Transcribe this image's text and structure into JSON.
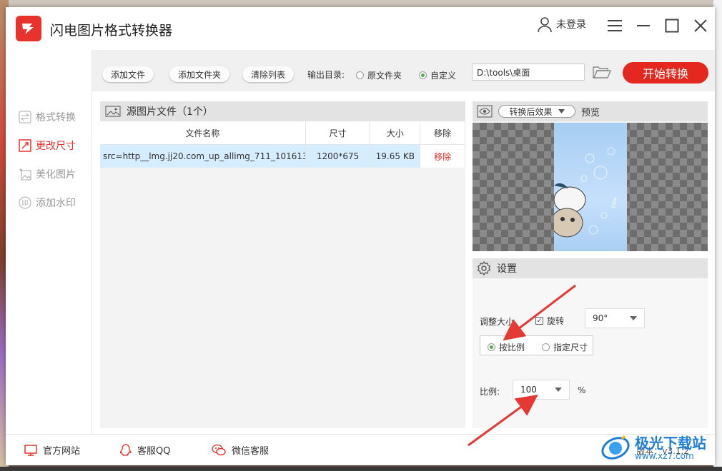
{
  "app": {
    "title": "闪电图片格式转换器",
    "user_label": "未登录"
  },
  "sidebar": {
    "items": [
      {
        "label": "格式转换",
        "icon": "swap-arrows-icon"
      },
      {
        "label": "更改尺寸",
        "icon": "resize-icon",
        "active": true
      },
      {
        "label": "美化图片",
        "icon": "sparkle-image-icon"
      },
      {
        "label": "添加水印",
        "icon": "stamp-icon"
      }
    ]
  },
  "toolbar": {
    "add_file": "添加文件",
    "add_folder": "添加文件夹",
    "clear_list": "清除列表",
    "output_label": "输出目录:",
    "radio_original": "原文件夹",
    "radio_custom": "自定义",
    "selected_output": "自定义",
    "path_value": "D:\\tools\\桌面",
    "start_button": "开始转换"
  },
  "file_panel": {
    "title": "源图片文件（1个）",
    "columns": [
      "文件名称",
      "尺寸",
      "大小",
      "移除"
    ],
    "rows": [
      {
        "name": "src=http__lmg.jj20.com_up_allimg_711_101613...",
        "size": "1200*675",
        "filesize": "19.65 KB",
        "remove": "移除"
      }
    ]
  },
  "preview": {
    "effect_select": "转换后效果",
    "label": "预览"
  },
  "settings": {
    "title": "设置",
    "resize_label": "调整大小",
    "rotate_label": "旋转",
    "rotate_checked": true,
    "rotate_value": "90°",
    "mode_ratio": "按比例",
    "mode_size": "指定尺寸",
    "selected_mode": "按比例",
    "ratio_label": "比例:",
    "ratio_value": "100",
    "ratio_unit": "%"
  },
  "footer": {
    "website": "官方网站",
    "qq": "客服QQ",
    "wechat": "微信客服",
    "version": "版本：v3.1.2"
  },
  "watermark": {
    "line1": "极光下载站",
    "line2": "www.xz7.com"
  },
  "colors": {
    "accent": "#e5281f",
    "selected_row": "#d6ecff",
    "radio_on": "#4caf50",
    "arrow": "#e53935"
  }
}
